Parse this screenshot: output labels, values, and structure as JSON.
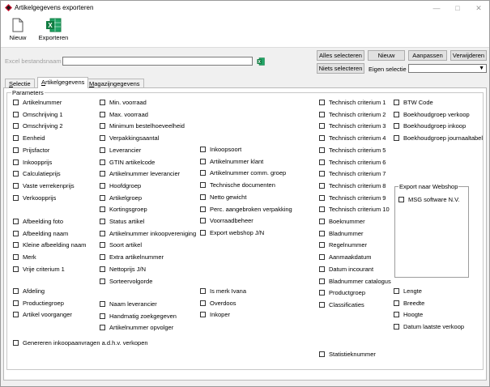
{
  "window": {
    "title": "Artikelgegevens exporteren"
  },
  "ribbon": {
    "nieuw": "Nieuw",
    "exporteren": "Exporteren"
  },
  "toolbar": {
    "file_label": "Excel bestandsnaam",
    "file_value": "",
    "alles_selecteren": "Alles selecteren",
    "niets_selecteren": "Niets selecteren",
    "nieuw": "Nieuw",
    "aanpassen": "Aanpassen",
    "verwijderen": "Verwijderen",
    "eigen_selectie_label": "Eigen selectie",
    "eigen_selectie_value": ""
  },
  "tabs": [
    {
      "label": "Selectie",
      "u": "S",
      "rest": "electie"
    },
    {
      "label": "Artikelgegevens",
      "u": "A",
      "rest": "rtikelgegevens"
    },
    {
      "label": "Magazijngegevens",
      "u": "M",
      "rest": "agazijngegevens"
    }
  ],
  "parameters": {
    "legend": "Parameters",
    "col1": [
      "Artikelnummer",
      "Omschrijving 1",
      "Omschrijving 2",
      "Eenheid",
      "Prijsfactor",
      "Inkoopprijs",
      "Calculatieprijs",
      "Vaste verrekenprijs",
      "Verkoopprijs"
    ],
    "col1b": [
      "Afbeelding foto",
      "Afbeelding naam",
      "Kleine afbeelding naam",
      "Merk",
      "Vrije criterium 1"
    ],
    "col1c": [
      "Afdeling",
      "Productiegroep",
      "Artikel voorganger"
    ],
    "col1d": [
      "Genereren inkoopaanvragen a.d.h.v. verkopen"
    ],
    "col2": [
      "Min. voorraad",
      "Max. voorraad",
      "Minimum bestelhoeveelheid",
      "Verpakkingsaantal",
      "Leverancier",
      "GTIN artikelcode",
      "Artikelnummer leverancier",
      "Hoofdgroep",
      "Artikelgroep",
      "Kortingsgroep",
      "Status artikel",
      "Artikelnummer inkoopvereniging",
      "Soort artikel",
      "Extra artikelnummer",
      "Nettoprijs J/N",
      "Sorteervolgorde"
    ],
    "col2b": [
      "Naam leverancier",
      "Handmatig zoekgegeven",
      "Artikelnummer opvolger"
    ],
    "col3": [
      "Inkoopsoort",
      "Artikelnummer klant",
      "Artikelnummer comm. groep",
      "Technische documenten",
      "Netto gewicht",
      "Perc. aangebroken verpakking",
      "Voorraadbeheer",
      "Export webshop J/N"
    ],
    "col3b": [
      "Is merk Ivana",
      "Overdoos",
      "Inkoper"
    ],
    "col4": [
      "Technisch criterium 1",
      "Technisch criterium 2",
      "Technisch criterium 3",
      "Technisch criterium 4",
      "Technisch criterium 5",
      "Technisch criterium 6",
      "Technisch criterium 7",
      "Technisch criterium 8",
      "Technisch criterium 9",
      "Technisch criterium 10",
      "Boeknummer",
      "Bladnummer",
      "Regelnummer",
      "Aanmaakdatum",
      "Datum incourant",
      "Bladnummer catalogus",
      "Productgroep",
      "Classificaties"
    ],
    "col4b": [
      "Statistieknummer"
    ],
    "col5": [
      "BTW Code",
      "Boekhoudgroep verkoop",
      "Boekhoudgroep inkoop",
      "Boekhoudgroep journaaltabel"
    ],
    "col5b": [
      "Lengte",
      "Breedte",
      "Hoogte",
      "Datum laatste verkoop"
    ],
    "webshop_legend": "Export naar Webshop",
    "webshop_items": [
      "MSG software N.V."
    ]
  }
}
